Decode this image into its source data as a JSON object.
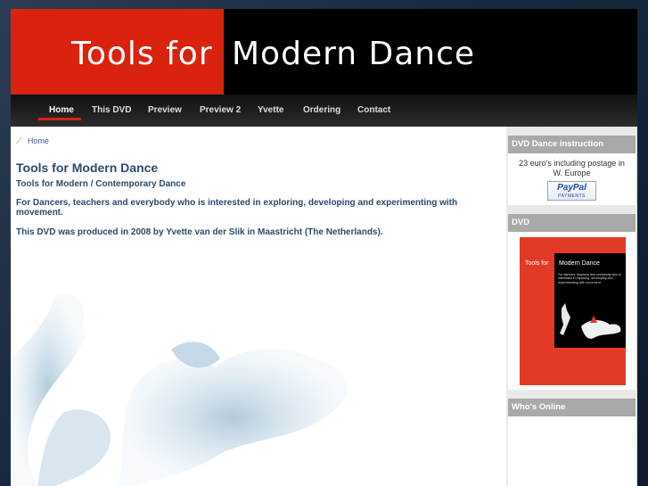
{
  "header": {
    "logo_part1": "Tools for",
    "logo_part2": "Modern Dance"
  },
  "nav": {
    "items": [
      "Home",
      "This DVD",
      "Preview",
      "Preview 2",
      "Yvette",
      "Ordering",
      "Contact"
    ],
    "active": "Home"
  },
  "breadcrumb": {
    "separator": "⟋",
    "current": "Home"
  },
  "main": {
    "title": "Tools for Modern Dance",
    "subtitle": "Tools for Modern / Contemporary Dance",
    "paragraph1": "For Dancers, teachers and everybody who is interested in exploring, developing and experimenting with movement.",
    "paragraph2": "This DVD was produced in 2008 by Yvette van der Slik in Maastricht (The Netherlands)."
  },
  "sidebar": {
    "instruction_heading": "DVD Dance instruction",
    "price_text": "23 euro's including postage in W. Europe",
    "paypal_logo": "PayPal",
    "paypal_sub": "PAYMENTS",
    "dvd_heading": "DVD",
    "cover_title_left": "Tools for",
    "cover_title_right": "Modern Dance",
    "cover_text": "For dancers, teachers and everybody who is interested in exploring, developing and experimenting with movement",
    "online_heading": "Who's Online"
  },
  "colors": {
    "brand_red": "#d9230f",
    "heading_blue": "#2c4a6b",
    "sidebar_header": "#a9a9a9"
  }
}
